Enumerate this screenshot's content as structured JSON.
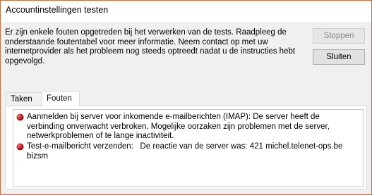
{
  "window": {
    "title": "Accountinstellingen testen"
  },
  "message": "Er zijn enkele fouten opgetreden bij het verwerken van de tests. Raadpleeg de onderstaande foutentabel voor meer informatie. Neem contact op met uw internetprovider als het probleem nog steeds optreedt nadat u de instructies hebt opgevolgd.",
  "buttons": {
    "stop_label": "Stoppen",
    "close_label": "Sluiten"
  },
  "tabs": [
    {
      "label": "Taken"
    },
    {
      "label": "Fouten"
    }
  ],
  "errors": [
    {
      "icon": "error-icon",
      "text": "Aanmelden bij server voor inkomende e-mailberichten (IMAP): De server heeft de verbinding onverwacht verbroken. Mogelijke oorzaken zijn problemen met de server, netwerkproblemen of te lange inactiviteit."
    },
    {
      "icon": "error-icon",
      "text": "Test-e-mailbericht verzenden:   De reactie van de server was: 421 michel.telenet-ops.be bizsm"
    }
  ],
  "colors": {
    "window_border": "#c86e3a",
    "error_icon": "#c4161c"
  }
}
